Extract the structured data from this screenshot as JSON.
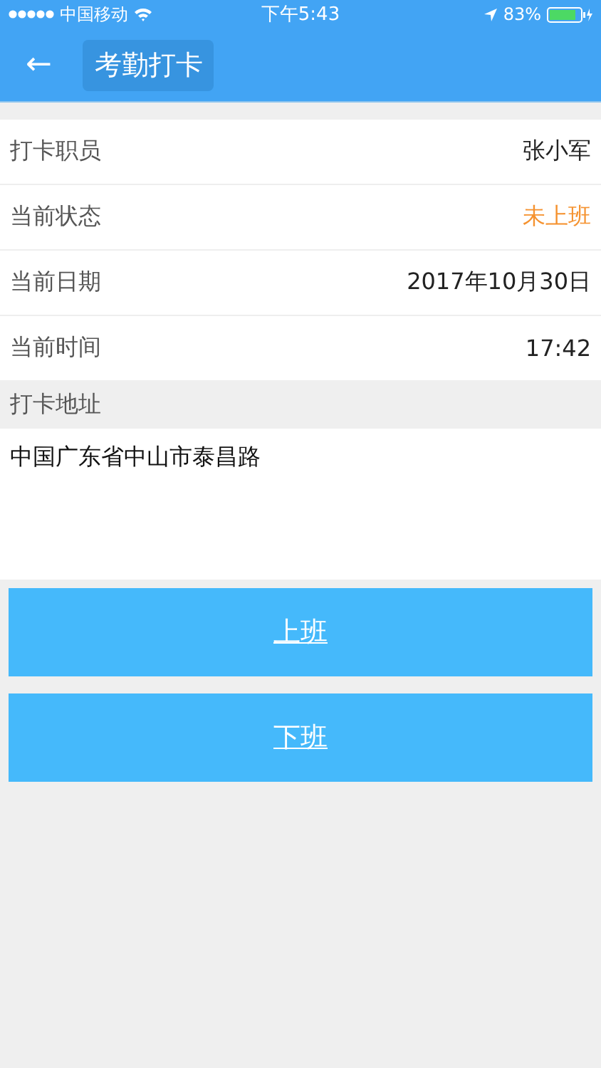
{
  "status_bar": {
    "carrier": "中国移动",
    "time": "下午5:43",
    "battery_percent": "83%"
  },
  "nav": {
    "back_icon": "←",
    "title": "考勤打卡"
  },
  "rows": [
    {
      "label": "打卡职员",
      "value": "张小军",
      "color": "#222222"
    },
    {
      "label": "当前状态",
      "value": "未上班",
      "color": "#f5922f"
    },
    {
      "label": "当前日期",
      "value": "2017年10月30日",
      "color": "#222222"
    },
    {
      "label": "当前时间",
      "value": "17:42",
      "color": "#222222"
    }
  ],
  "address": {
    "heading": "打卡地址",
    "text": "中国广东省中山市泰昌路"
  },
  "buttons": [
    "上班",
    "下班"
  ]
}
